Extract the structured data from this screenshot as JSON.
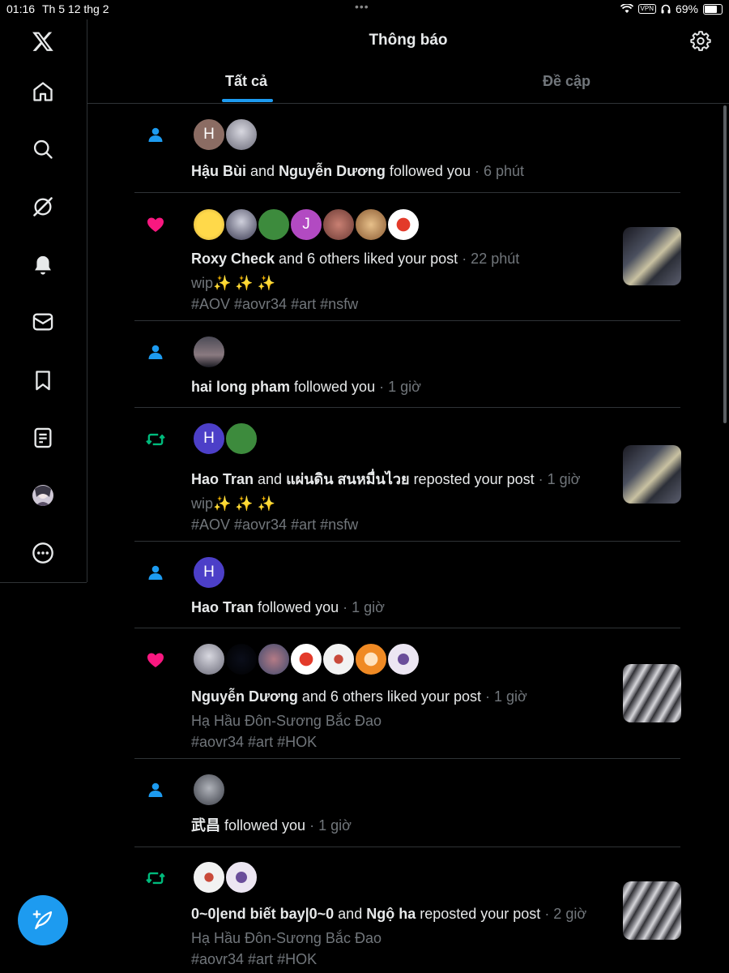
{
  "status_bar": {
    "time": "01:16",
    "date": "Th 5 12 thg 2",
    "dots": "•••",
    "vpn": "VPN",
    "battery": "69%"
  },
  "sidebar": {
    "items": [
      {
        "name": "x-logo-icon"
      },
      {
        "name": "home-icon"
      },
      {
        "name": "search-icon"
      },
      {
        "name": "grok-icon"
      },
      {
        "name": "bell-icon"
      },
      {
        "name": "mail-icon"
      },
      {
        "name": "bookmark-icon"
      },
      {
        "name": "lists-icon"
      },
      {
        "name": "profile-avatar"
      },
      {
        "name": "more-icon"
      }
    ],
    "compose": "compose-icon"
  },
  "header": {
    "title": "Thông báo",
    "tabs": [
      {
        "label": "Tất cả",
        "active": true
      },
      {
        "label": "Đề cập",
        "active": false
      }
    ]
  },
  "colors": {
    "accent": "#1d9bf0",
    "like": "#f91880",
    "repost": "#00ba7c",
    "muted": "#71767b"
  },
  "notifications": [
    {
      "type": "follow",
      "icon": "person-icon",
      "avatars": [
        "H",
        ""
      ],
      "actors": [
        "Hậu Bùi",
        " and ",
        "Nguyễn Dương"
      ],
      "action": " followed you",
      "time": " · 6 phút"
    },
    {
      "type": "like",
      "icon": "heart-icon",
      "avatars": [
        "",
        "",
        "",
        "J",
        "",
        "",
        ""
      ],
      "actors": [
        "Roxy Check"
      ],
      "action": " and 6 others liked your post",
      "time": " · 22 phút",
      "post": "wip✨ ✨ ✨",
      "tags": "#AOV #aovr34 #art #nsfw"
    },
    {
      "type": "follow",
      "icon": "person-icon",
      "avatars": [
        ""
      ],
      "actors": [
        "hai long pham"
      ],
      "action": " followed you",
      "time": " · 1 giờ"
    },
    {
      "type": "repost",
      "icon": "repost-icon",
      "avatars": [
        "H",
        ""
      ],
      "actors": [
        "Hao Tran",
        " and ",
        "แผ่นดิน สนหมื่นไวย"
      ],
      "action": " reposted your post",
      "time": " · 1 giờ",
      "post": "wip✨ ✨ ✨",
      "tags": "#AOV #aovr34 #art #nsfw"
    },
    {
      "type": "follow",
      "icon": "person-icon",
      "avatars": [
        "H"
      ],
      "actors": [
        "Hao Tran"
      ],
      "action": " followed you",
      "time": " · 1 giờ"
    },
    {
      "type": "like",
      "icon": "heart-icon",
      "avatars": [
        "",
        "",
        "",
        "",
        "",
        "",
        ""
      ],
      "actors": [
        "Nguyễn Dương"
      ],
      "action": " and 6 others liked your post",
      "time": " · 1 giờ",
      "post": "Hạ Hầu Đôn-Sương Bắc Đao",
      "tags": "#aovr34 #art #HOK"
    },
    {
      "type": "follow",
      "icon": "person-icon",
      "avatars": [
        ""
      ],
      "actors": [
        "武昌"
      ],
      "action": " followed you",
      "time": " · 1 giờ"
    },
    {
      "type": "repost",
      "icon": "repost-icon",
      "avatars": [
        "",
        ""
      ],
      "actors": [
        "0~0|end biết bay|0~0",
        " and ",
        "Ngộ ha"
      ],
      "action": " reposted your post",
      "time": " · 2 giờ",
      "post": "Hạ Hầu Đôn-Sương Bắc Đao",
      "tags": "#aovr34 #art #HOK"
    }
  ]
}
